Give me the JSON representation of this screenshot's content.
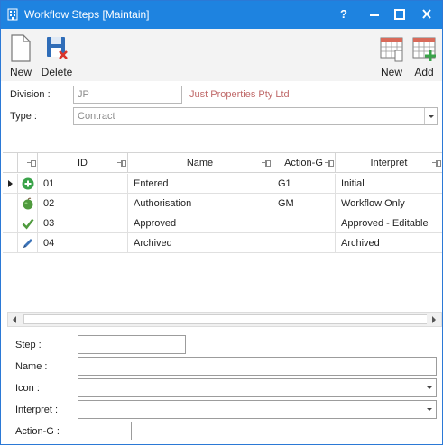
{
  "window": {
    "title": "Workflow Steps [Maintain]",
    "controls": {
      "help": "?",
      "minimize": "",
      "maximize": "",
      "close": ""
    }
  },
  "toolbar": {
    "new_label": "New",
    "delete_label": "Delete",
    "new2_label": "New",
    "add_label": "Add"
  },
  "header_form": {
    "division_label": "Division :",
    "division_value": "JP",
    "division_name": "Just Properties Pty Ltd",
    "type_label": "Type :",
    "type_value": "Contract"
  },
  "grid": {
    "columns": [
      "ID",
      "Name",
      "Action-G",
      "Interpret"
    ],
    "rows": [
      {
        "icon": "add-circle-icon",
        "id": "01",
        "name": "Entered",
        "action_g": "G1",
        "interpret": "Initial"
      },
      {
        "icon": "apple-icon",
        "id": "02",
        "name": "Authorisation",
        "action_g": "GM",
        "interpret": "Workflow Only"
      },
      {
        "icon": "check-icon",
        "id": "03",
        "name": "Approved",
        "action_g": "",
        "interpret": "Approved - Editable"
      },
      {
        "icon": "pencil-icon",
        "id": "04",
        "name": "Archived",
        "action_g": "",
        "interpret": "Archived"
      }
    ],
    "selected_row": 0
  },
  "detail_form": {
    "step_label": "Step :",
    "name_label": "Name :",
    "icon_label": "Icon :",
    "interpret_label": "Interpret :",
    "action_g_label": "Action-G :",
    "step_value": "",
    "name_value": "",
    "icon_value": "",
    "interpret_value": "",
    "action_g_value": ""
  },
  "colors": {
    "titlebar": "#1e83e0",
    "link": "#c06a6a",
    "add_icon": "#3aa34a",
    "delete_icon": "#d9342b"
  }
}
